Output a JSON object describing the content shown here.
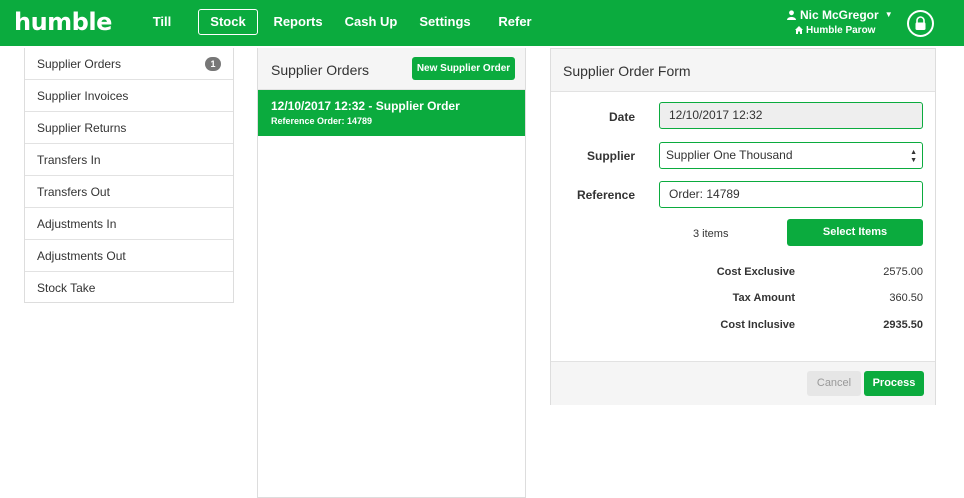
{
  "app": {
    "logo": "humble"
  },
  "nav": {
    "items": [
      {
        "label": "Till"
      },
      {
        "label": "Stock"
      },
      {
        "label": "Reports"
      },
      {
        "label": "Cash Up"
      },
      {
        "label": "Settings"
      },
      {
        "label": "Refer"
      }
    ],
    "active": "Stock"
  },
  "user": {
    "name": "Nic McGregor",
    "store": "Humble Parow",
    "menu_icon": "caret-down-icon",
    "store_icon": "home-icon",
    "lock_icon": "lock-icon"
  },
  "sidebar": {
    "items": [
      {
        "label": "Supplier Orders",
        "badge": "1"
      },
      {
        "label": "Supplier Invoices"
      },
      {
        "label": "Supplier Returns"
      },
      {
        "label": "Transfers In"
      },
      {
        "label": "Transfers Out"
      },
      {
        "label": "Adjustments In"
      },
      {
        "label": "Adjustments Out"
      },
      {
        "label": "Stock Take"
      }
    ]
  },
  "orders": {
    "title": "Supplier Orders",
    "new_button": "New Supplier Order",
    "list": [
      {
        "title": "12/10/2017 12:32 - Supplier Order",
        "reference": "Reference Order: 14789"
      }
    ]
  },
  "form": {
    "title": "Supplier Order Form",
    "date_label": "Date",
    "date_value": "12/10/2017 12:32",
    "supplier_label": "Supplier",
    "supplier_value": "Supplier One Thousand",
    "reference_label": "Reference",
    "reference_value": "Order: 14789",
    "items_count": "3 items",
    "select_items_button": "Select Items",
    "cost_exclusive_label": "Cost Exclusive",
    "cost_exclusive_value": "2575.00",
    "tax_amount_label": "Tax Amount",
    "tax_amount_value": "360.50",
    "cost_inclusive_label": "Cost Inclusive",
    "cost_inclusive_value": "2935.50",
    "cancel_button": "Cancel",
    "process_button": "Process"
  },
  "colors": {
    "brand": "#0bab3e",
    "panel_header": "#f5f5f5",
    "border": "#dddddd",
    "badge": "#777777"
  }
}
